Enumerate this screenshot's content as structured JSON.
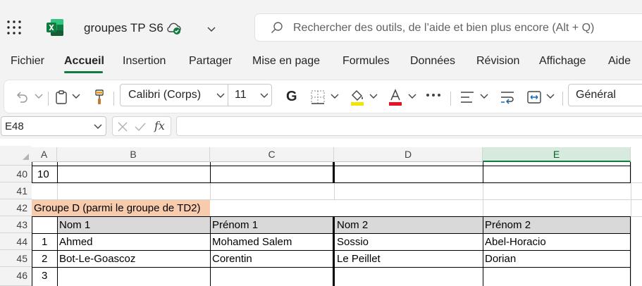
{
  "titlebar": {
    "doc_title": "groupes TP S6",
    "search_placeholder": "Rechercher des outils, de l’aide et bien plus encore (Alt + Q)"
  },
  "menu_tabs": [
    "Fichier",
    "Accueil",
    "Insertion",
    "Partager",
    "Mise en page",
    "Formules",
    "Données",
    "Révision",
    "Affichage",
    "Aide"
  ],
  "active_tab": "Accueil",
  "ribbon": {
    "font_name": "Calibri (Corps)",
    "font_size": "11",
    "bold_label": "G",
    "number_format": "Général"
  },
  "formula_bar": {
    "name_box": "E48",
    "fx_label": "fx",
    "formula": ""
  },
  "sheet": {
    "columns": [
      "A",
      "B",
      "C",
      "D",
      "E"
    ],
    "selected_column": "E",
    "rows": [
      {
        "num": "40",
        "cells": [
          "10",
          "",
          "",
          "",
          ""
        ]
      },
      {
        "num": "41",
        "cells": [
          "",
          "",
          "",
          "",
          ""
        ]
      },
      {
        "num": "42",
        "cells": [
          "Groupe D (parmi le groupe de TD2)",
          "",
          "",
          "",
          ""
        ]
      },
      {
        "num": "43",
        "cells": [
          "",
          "Nom 1",
          "Prénom 1",
          "Nom 2",
          "Prénom 2"
        ]
      },
      {
        "num": "44",
        "cells": [
          "1",
          "Ahmed",
          "Mohamed Salem",
          "Sossio",
          "Abel-Horacio"
        ]
      },
      {
        "num": "45",
        "cells": [
          "2",
          "Bot-Le-Goascoz",
          "Corentin",
          "Le Peillet",
          "Dorian"
        ]
      },
      {
        "num": "46",
        "cells": [
          "3",
          "",
          "",
          "",
          ""
        ]
      }
    ]
  },
  "colors": {
    "accent": "#107c41",
    "group_fill": "#f8cbad",
    "header_fill": "#d9d9d9",
    "selected_column_fill": "#d6ebdd"
  }
}
